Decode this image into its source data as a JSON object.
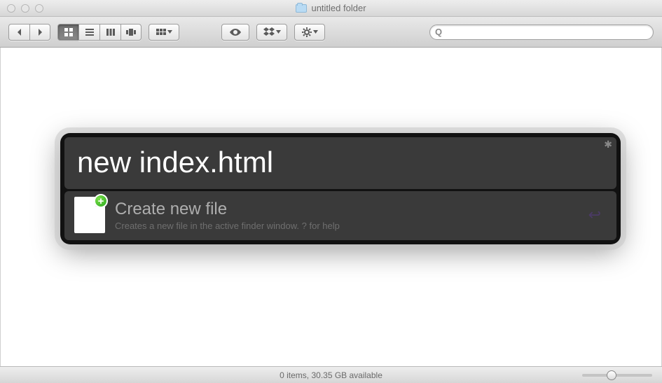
{
  "window": {
    "title": "untitled folder"
  },
  "search": {
    "placeholder": ""
  },
  "status": {
    "text": "0 items, 30.35 GB available"
  },
  "popup": {
    "input_value": "new index.html",
    "result": {
      "title": "Create new file",
      "subtitle": "Creates a new file in the active finder window. ? for help"
    }
  }
}
